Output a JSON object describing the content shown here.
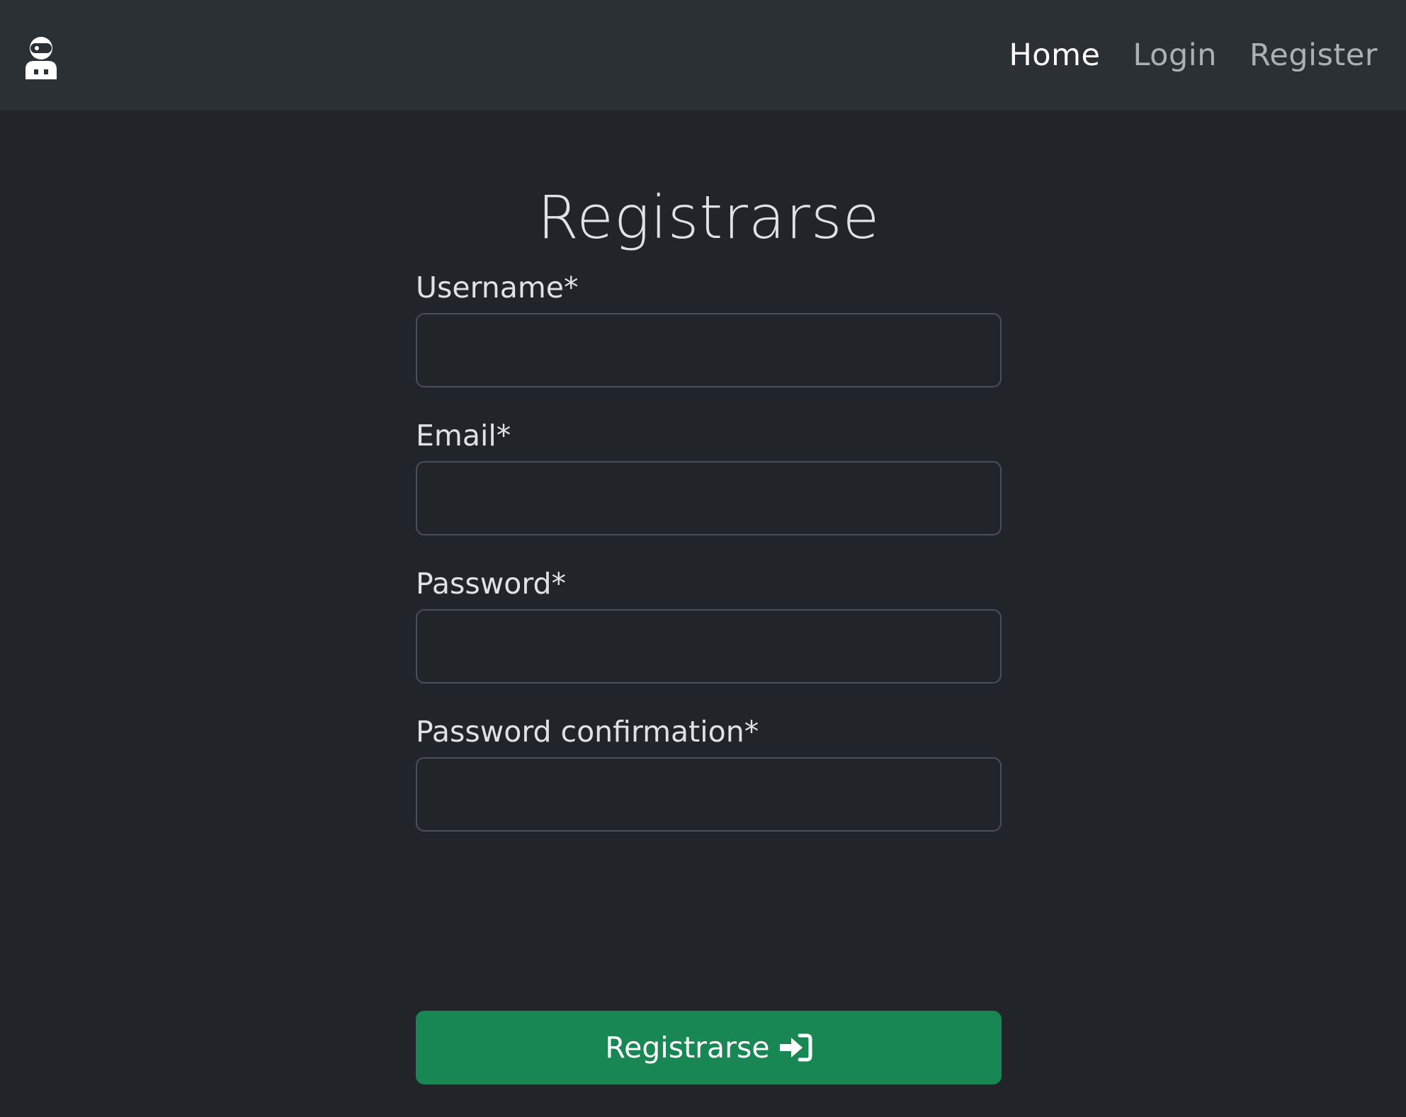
{
  "navbar": {
    "brand_icon": "astronaut-icon",
    "links": [
      {
        "label": "Home",
        "active": true
      },
      {
        "label": "Login",
        "active": false
      },
      {
        "label": "Register",
        "active": false
      }
    ]
  },
  "form": {
    "title": "Registrarse",
    "fields": [
      {
        "label": "Username*",
        "value": ""
      },
      {
        "label": "Email*",
        "value": ""
      },
      {
        "label": "Password*",
        "value": ""
      },
      {
        "label": "Password confirmation*",
        "value": ""
      }
    ],
    "submit_label": "Registrarse",
    "submit_icon": "sign-in-icon"
  },
  "colors": {
    "background": "#212529",
    "navbar": "#2b3035",
    "submit": "#198754"
  }
}
